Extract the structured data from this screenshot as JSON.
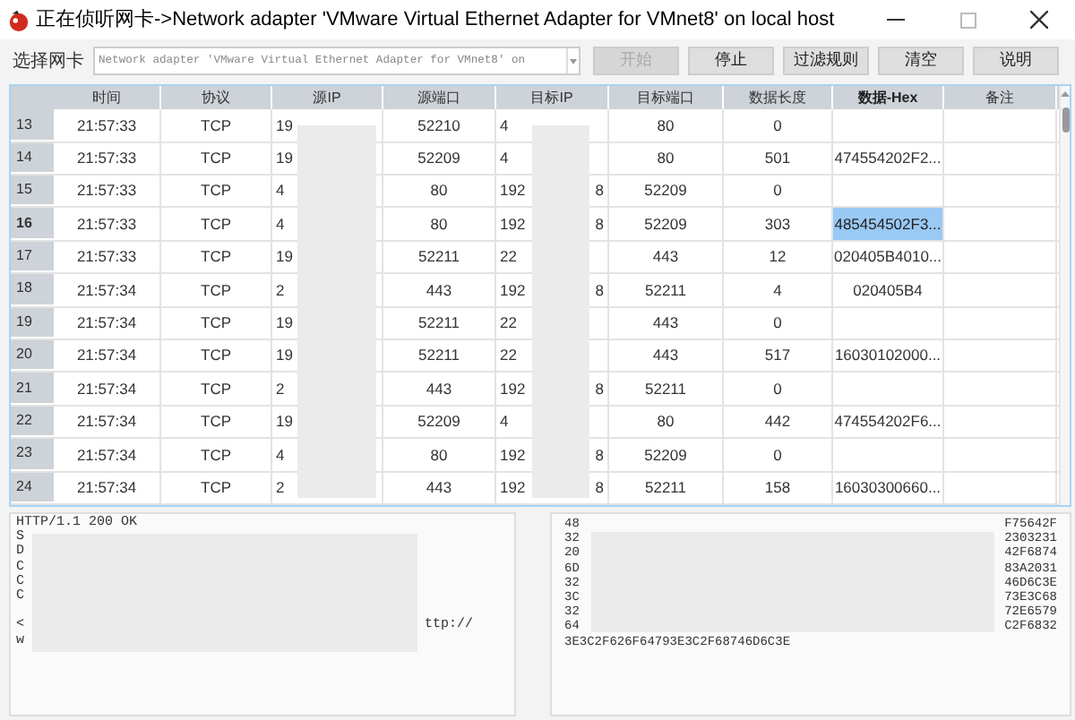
{
  "window": {
    "title": "正在侦听网卡->Network adapter 'VMware Virtual Ethernet Adapter for VMnet8' on local host"
  },
  "toolbar": {
    "label": "选择网卡",
    "adapter": "Network adapter 'VMware Virtual Ethernet Adapter for VMnet8' on",
    "buttons": [
      {
        "label": "开始",
        "disabled": true
      },
      {
        "label": "停止",
        "disabled": false
      },
      {
        "label": "过滤规则",
        "disabled": false
      },
      {
        "label": "清空",
        "disabled": false
      },
      {
        "label": "说明",
        "disabled": false
      }
    ]
  },
  "table": {
    "columns": [
      {
        "label": "时间",
        "selected": false
      },
      {
        "label": "协议",
        "selected": false
      },
      {
        "label": "源IP",
        "selected": false
      },
      {
        "label": "源端口",
        "selected": false
      },
      {
        "label": "目标IP",
        "selected": false
      },
      {
        "label": "目标端口",
        "selected": false
      },
      {
        "label": "数据长度",
        "selected": false
      },
      {
        "label": "数据-Hex",
        "selected": true
      },
      {
        "label": "备注",
        "selected": false
      }
    ],
    "rows": [
      {
        "number": "13",
        "time": "21:57:33",
        "protocol": "TCP",
        "src_ip": "19",
        "src_port": "52210",
        "dst_ip": "4",
        "dst_port": "80",
        "length": "0",
        "selected": false
      },
      {
        "number": "14",
        "time": "21:57:33",
        "protocol": "TCP",
        "src_ip": "19",
        "src_port": "52209",
        "dst_ip": "4",
        "dst_port": "80",
        "length": "501",
        "hex": "474554202F2...",
        "selected": false
      },
      {
        "number": "15",
        "time": "21:57:33",
        "protocol": "TCP",
        "src_ip": "4",
        "src_port": "80",
        "dst_ip": "192",
        "dst_ip_end": "8",
        "dst_port": "52209",
        "length": "0",
        "selected": false
      },
      {
        "number": "16",
        "time": "21:57:33",
        "protocol": "TCP",
        "src_ip": "4",
        "src_port": "80",
        "dst_ip": "192",
        "dst_ip_end": "8",
        "dst_port": "52209",
        "length": "303",
        "hex": "485454502F3...",
        "selected": true
      },
      {
        "number": "17",
        "time": "21:57:33",
        "protocol": "TCP",
        "src_ip": "19",
        "src_port": "52211",
        "dst_ip": "22",
        "dst_port": "443",
        "length": "12",
        "hex": "020405B4010...",
        "selected": false
      },
      {
        "number": "18",
        "time": "21:57:34",
        "protocol": "TCP",
        "src_ip": "2",
        "src_port": "443",
        "dst_ip": "192",
        "dst_ip_end": "8",
        "dst_port": "52211",
        "length": "4",
        "hex": "020405B4",
        "selected": false
      },
      {
        "number": "19",
        "time": "21:57:34",
        "protocol": "TCP",
        "src_ip": "19",
        "src_port": "52211",
        "dst_ip": "22",
        "dst_port": "443",
        "length": "0",
        "selected": false
      },
      {
        "number": "20",
        "time": "21:57:34",
        "protocol": "TCP",
        "src_ip": "19",
        "src_port": "52211",
        "dst_ip": "22",
        "dst_port": "443",
        "length": "517",
        "hex": "16030102000...",
        "selected": false
      },
      {
        "number": "21",
        "time": "21:57:34",
        "protocol": "TCP",
        "src_ip": "2",
        "src_port": "443",
        "dst_ip": "192",
        "dst_ip_end": "8",
        "dst_port": "52211",
        "length": "0",
        "selected": false
      },
      {
        "number": "22",
        "time": "21:57:34",
        "protocol": "TCP",
        "src_ip": "19",
        "src_port": "52209",
        "dst_ip": "4",
        "dst_port": "80",
        "length": "442",
        "hex": "474554202F6...",
        "selected": false
      },
      {
        "number": "23",
        "time": "21:57:34",
        "protocol": "TCP",
        "src_ip": "4",
        "src_port": "80",
        "dst_ip": "192",
        "dst_ip_end": "8",
        "dst_port": "52209",
        "length": "0",
        "selected": false
      },
      {
        "number": "24",
        "time": "21:57:34",
        "protocol": "TCP",
        "src_ip": "2",
        "src_port": "443",
        "dst_ip": "192",
        "dst_ip_end": "8",
        "dst_port": "52211",
        "length": "158",
        "hex": "16030300660...",
        "selected": false
      }
    ]
  },
  "text_panel": {
    "lines": [
      {
        "start": "HTTP/1.1 200 OK"
      },
      {
        "start": "S"
      },
      {
        "start": "D"
      },
      {
        "start": "C"
      },
      {
        "start": "C"
      },
      {
        "start": "C"
      },
      {
        "start": "<",
        "end": "ttp://",
        "blank_line_before": true
      },
      {
        "start": "w"
      }
    ]
  },
  "hex_panel": {
    "lines": [
      {
        "start": "48",
        "end": "F75642F"
      },
      {
        "start": "32",
        "end": "2303231"
      },
      {
        "start": "20",
        "end": "42F6874"
      },
      {
        "start": "6D",
        "end": "83A2031"
      },
      {
        "start": "32",
        "end": "46D6C3E"
      },
      {
        "start": "3C",
        "end": "73E3C68"
      },
      {
        "start": "32",
        "end": "72E6579"
      },
      {
        "start": "64",
        "end": "C2F6832"
      },
      {
        "start": "3E3C2F626F64793E3C2F68746D6C3E"
      }
    ]
  }
}
